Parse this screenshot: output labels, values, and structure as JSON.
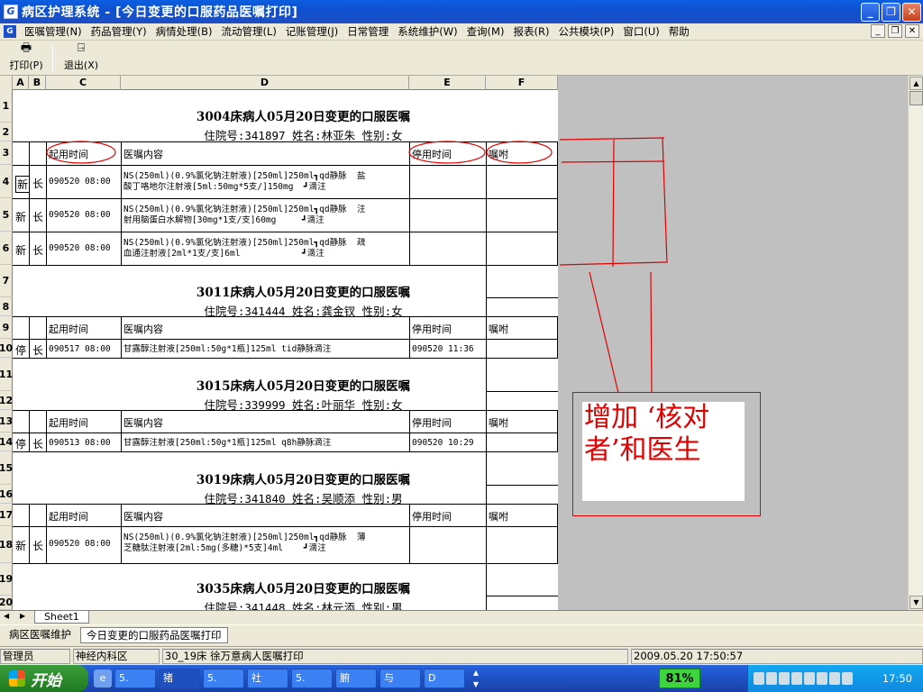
{
  "window": {
    "title": "病区护理系统 - [今日变更的口服药品医嘱打印]",
    "icon_letter": "G"
  },
  "menu": [
    "医嘱管理(N)",
    "药品管理(Y)",
    "病情处理(B)",
    "流动管理(L)",
    "记账管理(J)",
    "日常管理",
    "系统维护(W)",
    "查询(M)",
    "报表(R)",
    "公共模块(P)",
    "窗口(U)",
    "帮助"
  ],
  "toolbar": {
    "print_label": "打印(P)",
    "exit_label": "退出(X)"
  },
  "columns": [
    "A",
    "B",
    "C",
    "D",
    "E",
    "F"
  ],
  "rows": [
    "1",
    "2",
    "3",
    "4",
    "5",
    "6",
    "7",
    "8",
    "9",
    "10",
    "11",
    "12",
    "13",
    "14",
    "15",
    "16",
    "17",
    "18",
    "19",
    "20"
  ],
  "headers": {
    "start": "起用时间",
    "content": "医嘱内容",
    "stop": "停用时间",
    "note": "嘱咐"
  },
  "patients": [
    {
      "title": "3004床病人05月20日变更的口服医嘱",
      "info": "住院号:341897  姓名:林亚朱  性别:女"
    },
    {
      "title": "3011床病人05月20日变更的口服医嘱",
      "info": "住院号:341444  姓名:龚金钗  性别:女"
    },
    {
      "title": "3015床病人05月20日变更的口服医嘱",
      "info": "住院号:339999  姓名:叶丽华  性别:女"
    },
    {
      "title": "3019床病人05月20日变更的口服医嘱",
      "info": "住院号:341840  姓名:吴顺添  性别:男"
    },
    {
      "title": "3035床病人05月20日变更的口服医嘱",
      "info": "住院号:341448  姓名:林元添  性别:男"
    }
  ],
  "orders": [
    {
      "a": "新",
      "b": "长",
      "start": "090520 08:00",
      "line1": "NS(250ml)(0.9%氯化钠注射液)[250ml]250ml┓qd静脉  盐",
      "line2": "酸丁咯地尔注射液[5ml:50mg*5支/]150mg  ┛滴注",
      "stop": ""
    },
    {
      "a": "新",
      "b": "长",
      "start": "090520 08:00",
      "line1": "NS(250ml)(0.9%氯化钠注射液)[250ml]250ml┓qd静脉  注",
      "line2": "射用脑蛋白水解物[30mg*1支/支]60mg     ┛滴注",
      "stop": ""
    },
    {
      "a": "新",
      "b": "长",
      "start": "090520 08:00",
      "line1": "NS(250ml)(0.9%氯化钠注射液)[250ml]250ml┓qd静脉  疏",
      "line2": "血通注射液[2ml*1支/支]6ml            ┛滴注",
      "stop": ""
    },
    {
      "a": "停",
      "b": "长",
      "start": "090517 08:00",
      "line1": "甘露醇注射液[250ml:50g*1瓶]125ml tid静脉滴注",
      "line2": "",
      "stop": "090520 11:36"
    },
    {
      "a": "停",
      "b": "长",
      "start": "090513 08:00",
      "line1": "甘露醇注射液[250ml:50g*1瓶]125ml q8h静脉滴注",
      "line2": "",
      "stop": "090520 10:29"
    },
    {
      "a": "新",
      "b": "长",
      "start": "090520 08:00",
      "line1": "NS(250ml)(0.9%氯化钠注射液)[250ml]250ml┓qd静脉  薄",
      "line2": "芝糖肽注射液[2ml:5mg(多糖)*5支]4ml    ┛滴注",
      "stop": ""
    }
  ],
  "annotation": {
    "text": "增加  ‘核对者’和医生",
    "color": "#e00000"
  },
  "sheet_tab": "Sheet1",
  "doc_tabs": [
    "病区医嘱维护",
    "今日变更的口服药品医嘱打印"
  ],
  "status": {
    "user": "管理员",
    "dept": "神经内科区",
    "patient": "30_19床 徐万意病人医嘱打印",
    "datetime": "2009.05.20 17:50:57"
  },
  "taskbar": {
    "start": "开始",
    "tasks": [
      "5.",
      "猪",
      "5.",
      "社",
      "5.",
      "腑",
      "与",
      "D"
    ],
    "zoom": "81%",
    "clock": "17:50"
  }
}
